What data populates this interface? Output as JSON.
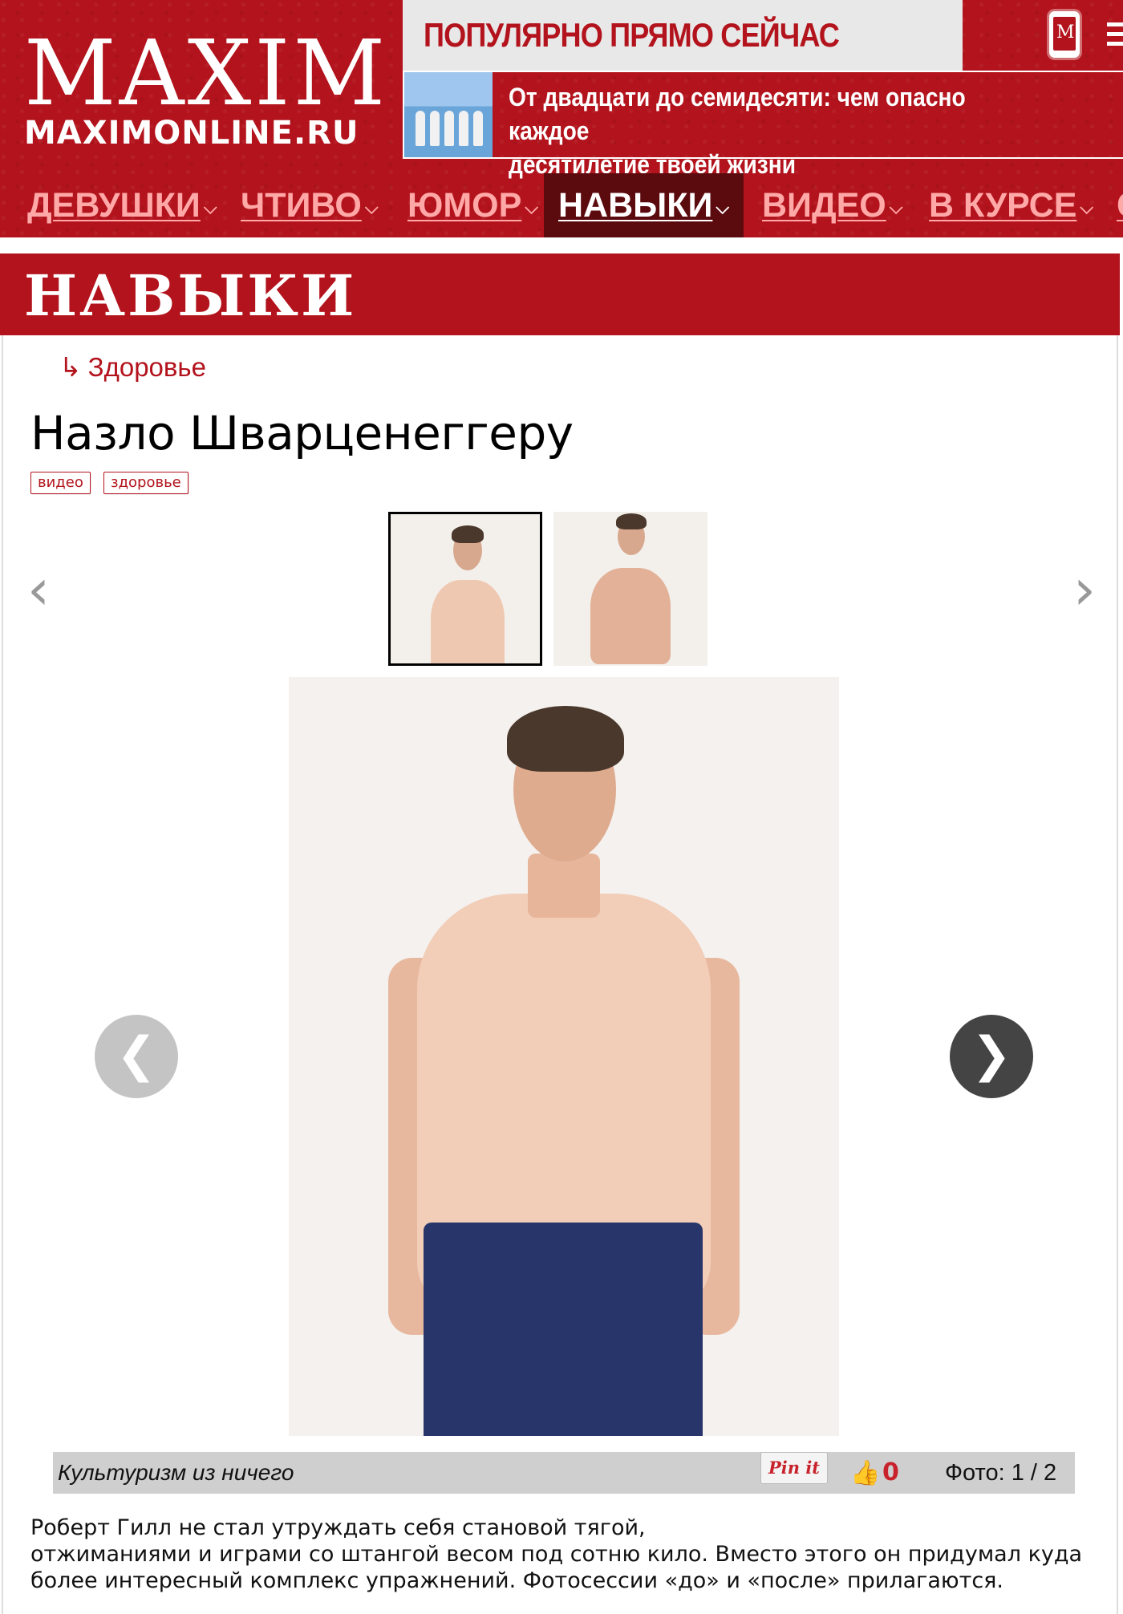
{
  "logo": {
    "main": "MAXIM",
    "sub": "MAXIMONLINE.RU"
  },
  "popular": {
    "title": "ПОПУЛЯРНО ПРЯМО СЕЙЧАС",
    "story_line1": "От двадцати до семидесяти: чем опасно каждое",
    "story_line2": "десятилетие твоей жизни"
  },
  "mobile_icon_letter": "M",
  "nav": {
    "items": [
      {
        "label": "ДЕВУШКИ"
      },
      {
        "label": "ЧТИВО"
      },
      {
        "label": "ЮМОР"
      },
      {
        "label": "НАВЫКИ"
      },
      {
        "label": "ВИДЕО"
      },
      {
        "label": "В КУРСЕ"
      },
      {
        "label": "С"
      }
    ],
    "chevron": "⌵"
  },
  "section": {
    "title": "НАВЫКИ"
  },
  "breadcrumb": {
    "arrow": "↳",
    "label": "Здоровье"
  },
  "article": {
    "title": "Назло Шварценеггеру",
    "tags": [
      "видео",
      "здоровье"
    ],
    "lead_line1": "Роберт Гилл не стал утруждать себя становой тягой,",
    "lead_line2": "отжиманиями и играми со штангой весом под сотню кило. Вместо этого он придумал куда",
    "lead_line3": "более интересный комплекс упражнений. Фотосессии «до» и «после» прилагаются."
  },
  "gallery": {
    "prev_arrow": "‹",
    "next_arrow": "›",
    "round_prev": "❮",
    "round_next": "❯",
    "caption": "Культуризм из ничего",
    "pin_label": "Pin it",
    "like_icon": "👍",
    "likes": "0",
    "photo_label": "Фото: 1 / 2",
    "selected_index": 1
  },
  "colors": {
    "brand_red": "#b3131c",
    "nav_active": "#5b0a0e",
    "nav_text": "#ffa8a8"
  }
}
